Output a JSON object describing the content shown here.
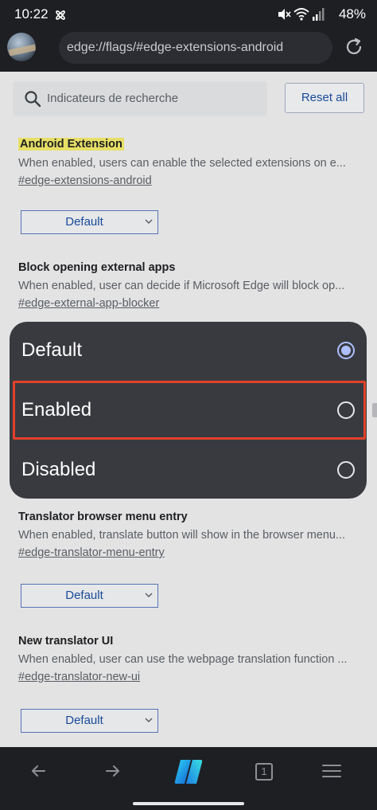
{
  "status_bar": {
    "time": "10:22",
    "battery": "48%",
    "icons": [
      "settings-fan-icon",
      "mute-icon",
      "wifi-icon",
      "signal-icon",
      "battery-icon"
    ]
  },
  "address_bar": {
    "url": "edge://flags/#edge-extensions-android",
    "icons": [
      "profile-avatar",
      "reload-icon"
    ]
  },
  "toolbar": {
    "search_placeholder": "Indicateurs de recherche",
    "reset_label": "Reset all"
  },
  "flags": [
    {
      "title": "Android Extension",
      "description": "When enabled, users can enable the selected extensions on e...",
      "link": "#edge-extensions-android",
      "value": "Default"
    },
    {
      "title": "Block opening external apps",
      "description": "When enabled, user can decide if Microsoft Edge will block op...",
      "link": "#edge-external-app-blocker",
      "value": "Default"
    },
    {
      "title": "Translator browser menu entry",
      "description": "When enabled, translate button will show in the browser menu...",
      "link": "#edge-translator-menu-entry",
      "value": "Default"
    },
    {
      "title": "New translator UI",
      "description": "When enabled, user can use the webpage translation function ...",
      "link": "#edge-translator-new-ui",
      "value": "Default"
    }
  ],
  "dialog": {
    "options": [
      {
        "label": "Default",
        "selected": true
      },
      {
        "label": "Enabled",
        "selected": false
      },
      {
        "label": "Disabled",
        "selected": false
      }
    ],
    "highlighted_option": "Enabled"
  },
  "bottom_nav": {
    "tab_count": "1",
    "icons": [
      "back-arrow-icon",
      "forward-arrow-icon",
      "copilot-icon",
      "tabs-icon",
      "menu-icon"
    ]
  },
  "colors": {
    "accent": "#1a4fa3",
    "dialog_bg": "#393a3f",
    "highlight": "#e2412b",
    "radio_selected": "#aebfff",
    "flag_highlight": "#f5ec6c"
  }
}
